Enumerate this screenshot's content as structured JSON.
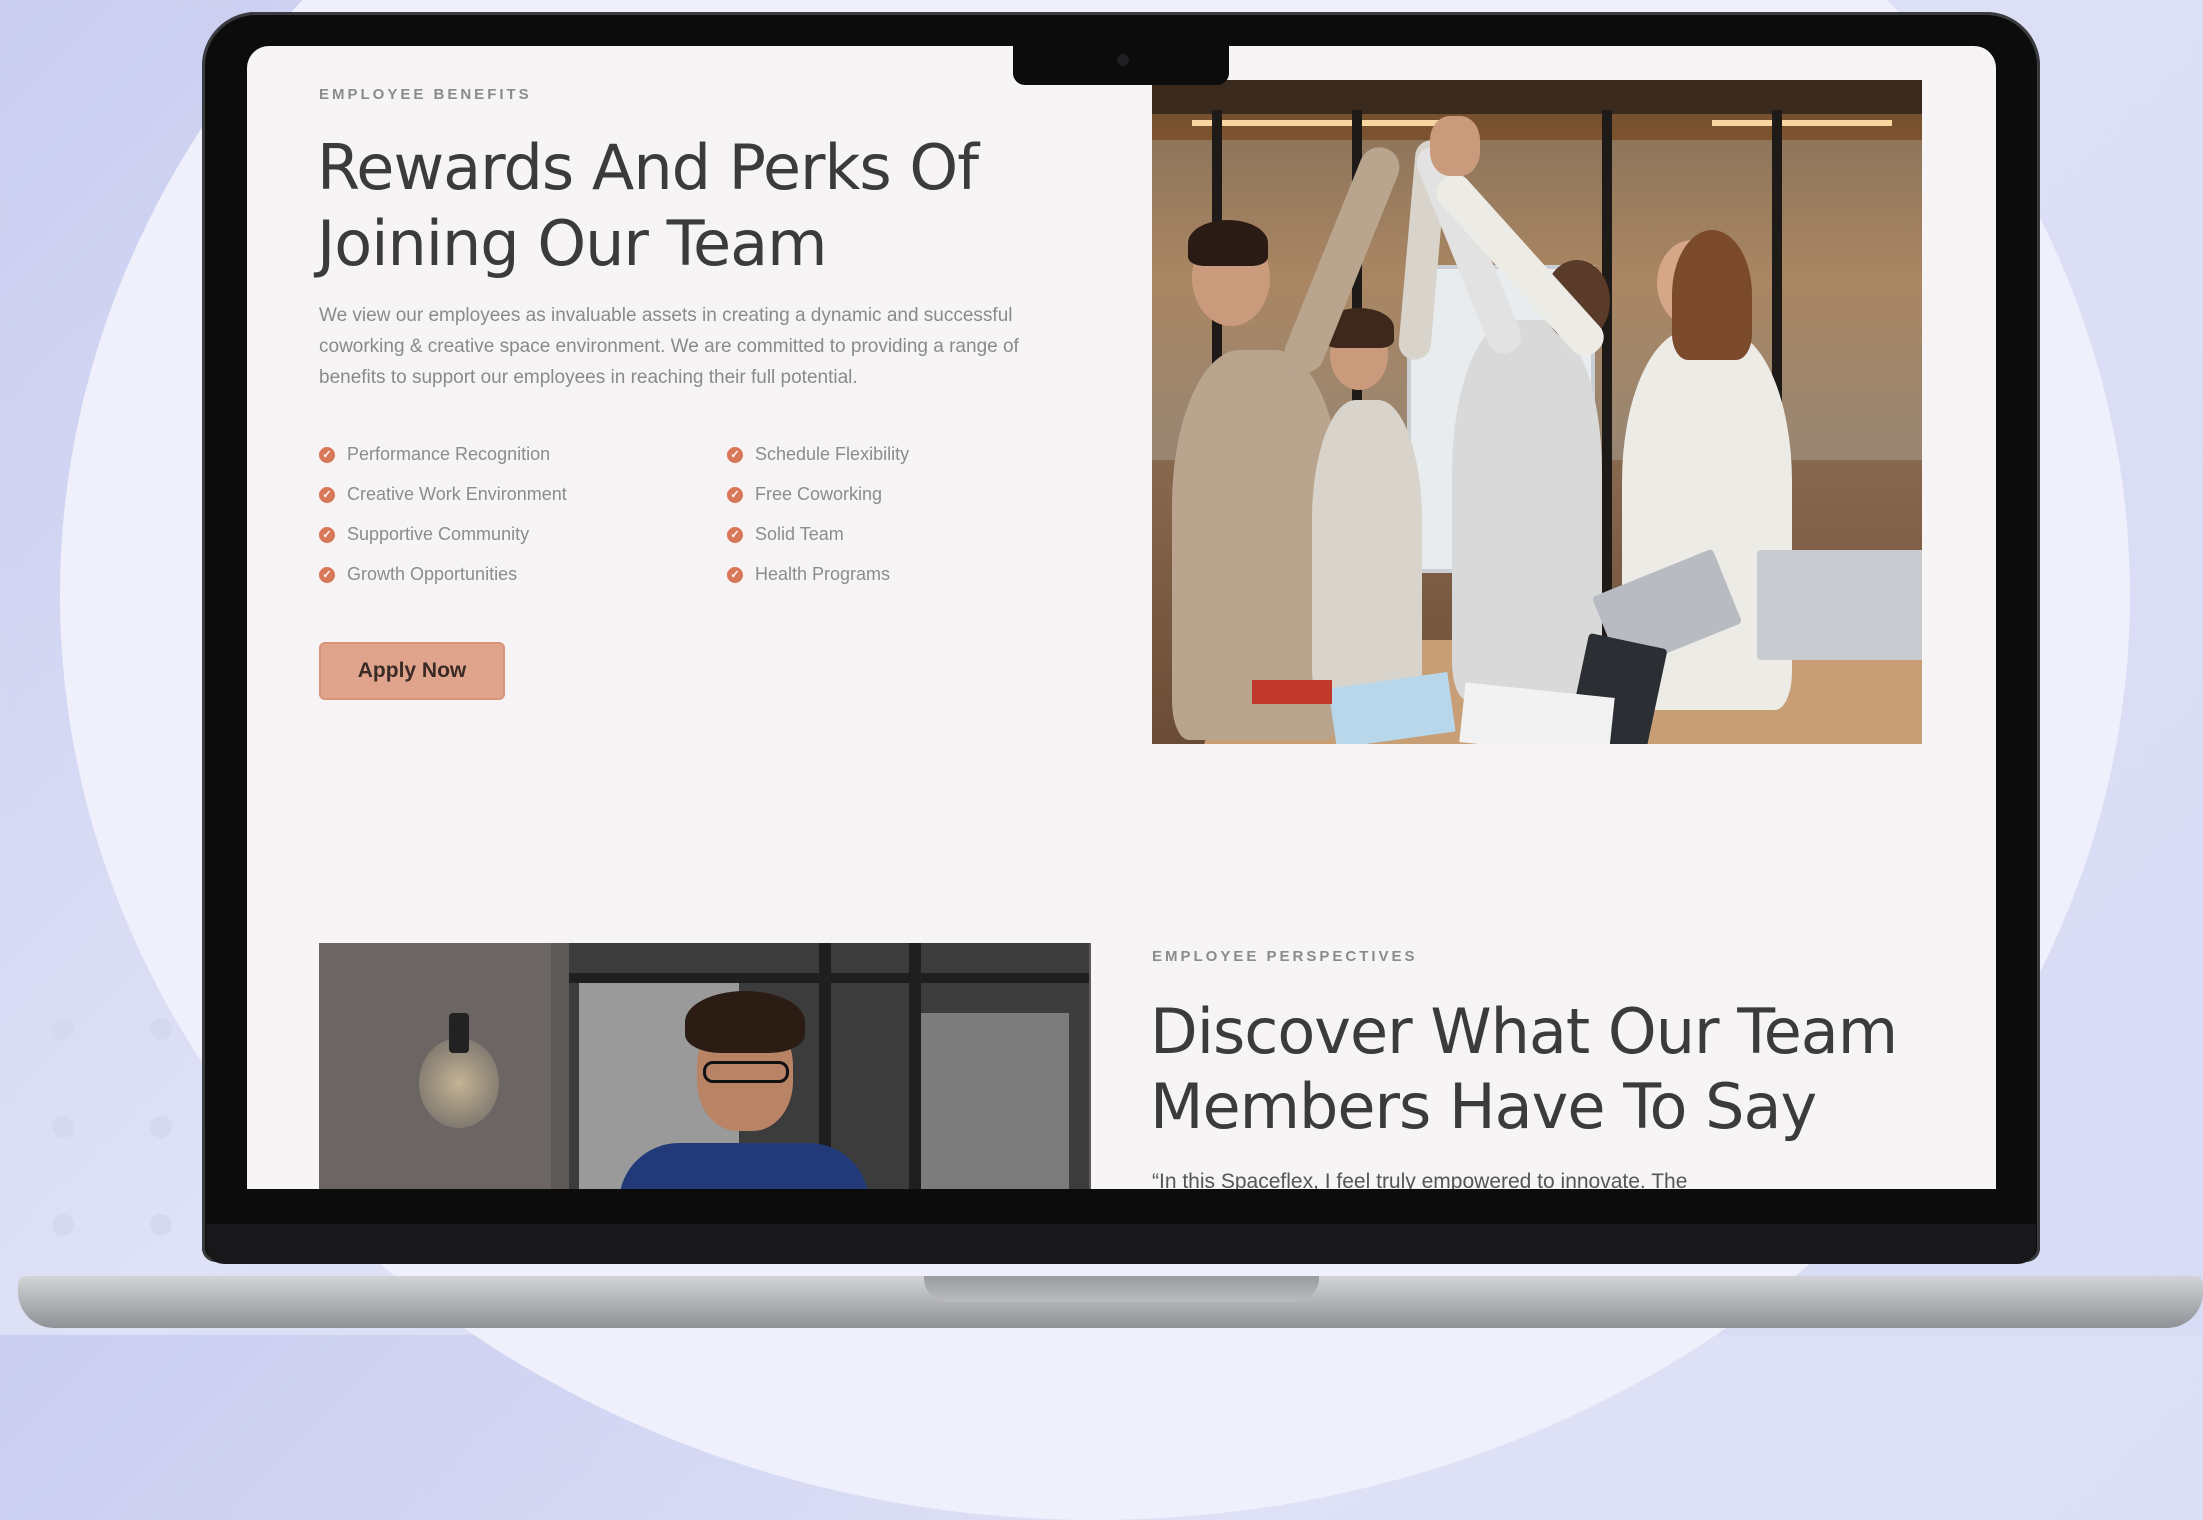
{
  "benefits_section": {
    "eyebrow": "EMPLOYEE BENEFITS",
    "title_line1": "Rewards And Perks Of",
    "title_line2": "Joining Our Team",
    "description": "We view our employees as invaluable assets in creating a dynamic and successful coworking & creative space environment. We are committed to providing a range of benefits to support our employees in reaching their full potential.",
    "benefits": [
      "Performance Recognition",
      "Creative Work Environment",
      "Supportive Community",
      "Growth Opportunities",
      "Schedule Flexibility",
      "Free Coworking",
      "Solid Team",
      "Health Programs"
    ],
    "apply_label": "Apply Now"
  },
  "perspectives_section": {
    "eyebrow": "EMPLOYEE PERSPECTIVES",
    "title_line1": "Discover What Our Team",
    "title_line2": "Members Have To Say",
    "quote": "“In this Spaceflex, I feel truly empowered to innovate. The"
  },
  "colors": {
    "accent": "#e0a48d",
    "check": "#d9775a",
    "heading": "#3b3b3b",
    "screen_bg": "#f6f4f4"
  },
  "icons": {
    "benefit_bullet": "check-circle-icon"
  }
}
